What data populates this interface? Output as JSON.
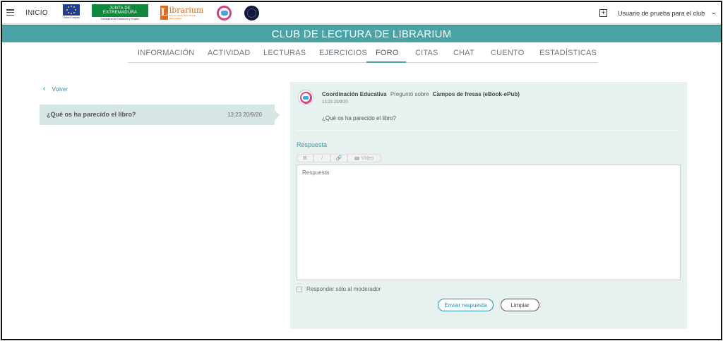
{
  "topbar": {
    "home_label": "INICIO",
    "user_name": "Usuario de prueba para el club",
    "logos": {
      "eu_caption": "Unión Europea",
      "jex_title": "JUNTA DE EXTREMADURA",
      "jex_caption": "Consejería de Educación y Empleo",
      "librarium_word": "ibrarium",
      "librarium_letter": "L",
      "librarium_sub": "Red de clubes de lectura de Extremadura"
    },
    "chevron": "⌄",
    "plus": "+"
  },
  "banner": {
    "title": "CLUB DE LECTURA DE LIBRARIUM"
  },
  "tabs": [
    {
      "label": "INFORMACIÓN"
    },
    {
      "label": "ACTIVIDAD"
    },
    {
      "label": "LECTURAS"
    },
    {
      "label": "EJERCICIOS"
    },
    {
      "label": "FORO",
      "active": true
    },
    {
      "label": "CITAS"
    },
    {
      "label": "CHAT"
    },
    {
      "label": "CUENTO"
    },
    {
      "label": "ESTADÍSTICAS"
    }
  ],
  "left": {
    "back_label": "Volver",
    "back_arrow": "‹",
    "question": {
      "title": "¿Qué os ha parecido el libro?",
      "date": "13:23 20/9/20"
    }
  },
  "panel": {
    "author": "Coordinación Educativa",
    "asked_label": "Preguntó sobre",
    "book": "Campos de fresas (eBook-ePub)",
    "date": "13:23 20/9/20",
    "question": "¿Qué os ha parecido el libro?",
    "response_label": "Respuesta",
    "toolbar": {
      "bold": "B",
      "italic": "I",
      "link": "🔗",
      "video": "Vídeo"
    },
    "textarea_placeholder": "Respuesta",
    "moderator_only_label": "Responder sólo al moderador",
    "send_label": "Enviar respuesta",
    "clear_label": "Limpiar"
  },
  "colors": {
    "teal": "#4aa3a5",
    "link_blue": "#2a8fb0",
    "panel_bg": "#e6f1f0",
    "card_bg": "#d5e6e4"
  }
}
